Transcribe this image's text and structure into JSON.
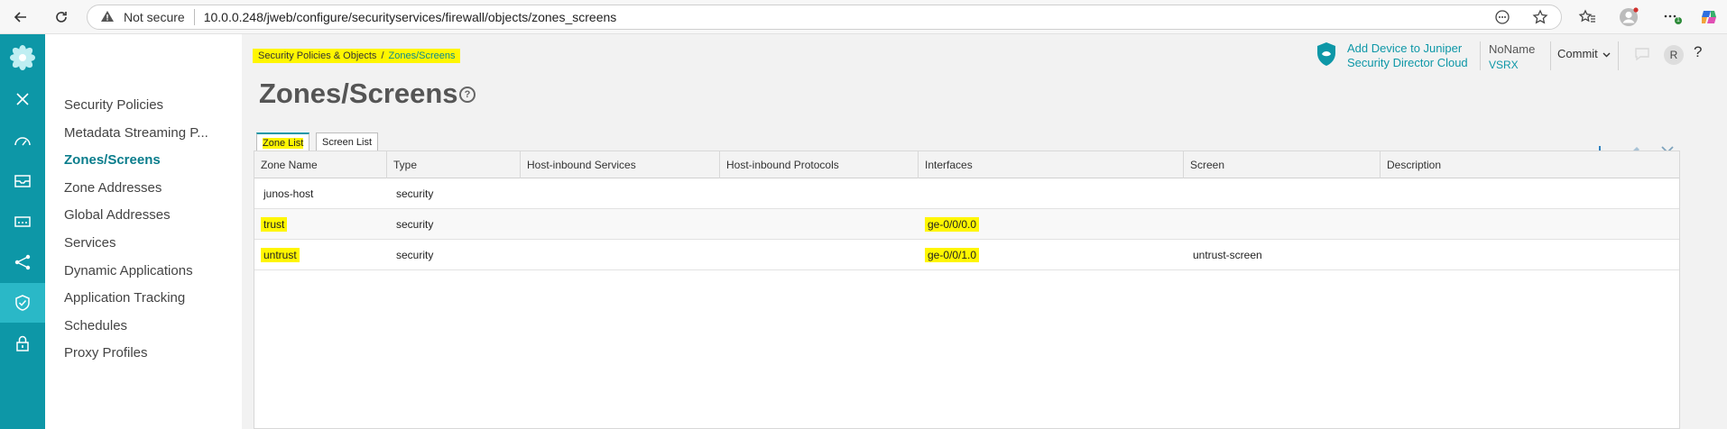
{
  "browser": {
    "security_label": "Not secure",
    "url": "10.0.0.248/jweb/configure/securityservices/firewall/objects/zones_screens",
    "notification_count": "1"
  },
  "sidebar": {
    "items": [
      {
        "label": "Security Policies"
      },
      {
        "label": "Metadata Streaming P..."
      },
      {
        "label": "Zones/Screens"
      },
      {
        "label": "Zone Addresses"
      },
      {
        "label": "Global Addresses"
      },
      {
        "label": "Services"
      },
      {
        "label": "Dynamic Applications"
      },
      {
        "label": "Application Tracking"
      },
      {
        "label": "Schedules"
      },
      {
        "label": "Proxy Profiles"
      }
    ]
  },
  "breadcrumb": {
    "parent": "Security Policies & Objects",
    "separator": "/",
    "current": "Zones/Screens"
  },
  "page": {
    "title": "Zones/Screens",
    "help": "?"
  },
  "header": {
    "sd_line1": "Add Device to Juniper",
    "sd_line2": "Security Director Cloud",
    "device_name": "NoName",
    "device_type": "VSRX",
    "commit_label": "Commit",
    "avatar_initial": "R",
    "help": "?"
  },
  "tabs": [
    {
      "label": "Zone List",
      "active": true
    },
    {
      "label": "Screen List",
      "active": false
    }
  ],
  "table": {
    "columns": [
      "Zone Name",
      "Type",
      "Host-inbound Services",
      "Host-inbound Protocols",
      "Interfaces",
      "Screen",
      "Description"
    ],
    "rows": [
      {
        "zone": "junos-host",
        "type": "security",
        "services": "",
        "protocols": "",
        "interfaces": "",
        "screen": "",
        "description": ""
      },
      {
        "zone": "trust",
        "type": "security",
        "services": "",
        "protocols": "",
        "interfaces": "ge-0/0/0.0",
        "screen": "",
        "description": ""
      },
      {
        "zone": "untrust",
        "type": "security",
        "services": "",
        "protocols": "",
        "interfaces": "ge-0/0/1.0",
        "screen": "untrust-screen",
        "description": ""
      }
    ]
  },
  "colors": {
    "rail": "#0d97a7",
    "accent": "#0a7d8c",
    "highlight": "#fff600"
  }
}
